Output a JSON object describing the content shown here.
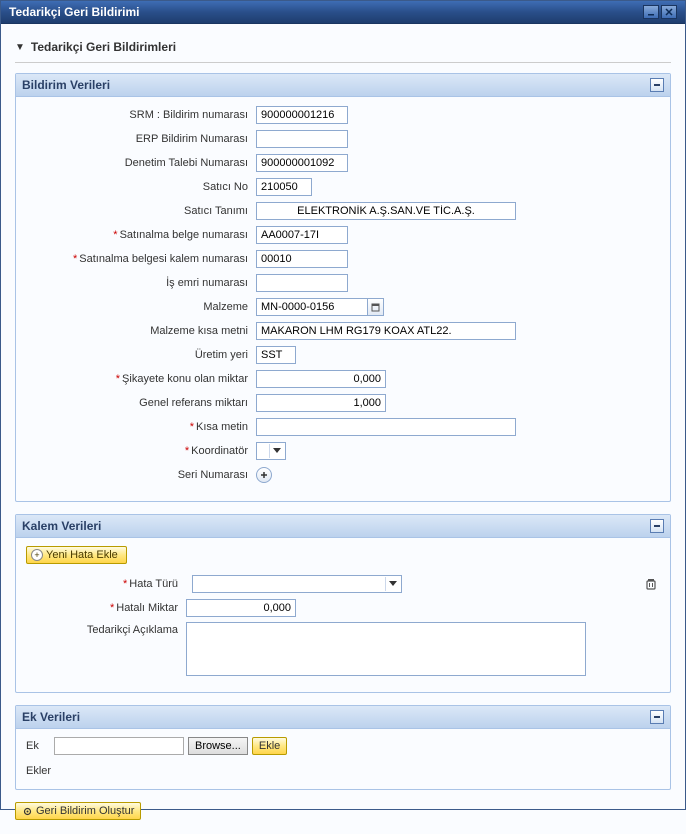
{
  "window": {
    "title": "Tedarikçi Geri Bildirimi"
  },
  "section1": {
    "title": "Tedarikçi Geri Bildirimleri"
  },
  "panelBildirim": {
    "title": "Bildirim Verileri",
    "fields": {
      "srm_label": "SRM : Bildirim numarası",
      "srm_value": "900000001216",
      "erp_label": "ERP Bildirim Numarası",
      "erp_value": "",
      "denetim_label": "Denetim Talebi Numarası",
      "denetim_value": "900000001092",
      "satici_no_label": "Satıcı No",
      "satici_no_value": "210050",
      "satici_tanimi_label": "Satıcı Tanımı",
      "satici_tanimi_value": "ELEKTRONİK A.Ş.SAN.VE TİC.A.Ş.",
      "satinalma_belge_label": "Satınalma belge numarası",
      "satinalma_belge_value": "AA0007-17I",
      "satinalma_kalem_label": "Satınalma belgesi kalem numarası",
      "satinalma_kalem_value": "00010",
      "is_emri_label": "İş emri numarası",
      "is_emri_value": "",
      "malzeme_label": "Malzeme",
      "malzeme_value": "MN-0000-0156",
      "malzeme_kisa_label": "Malzeme kısa metni",
      "malzeme_kisa_value": "MAKARON LHM RG179 KOAX ATL22.",
      "uretim_label": "Üretim yeri",
      "uretim_value": "SST",
      "sikayet_label": "Şikayete konu olan miktar",
      "sikayet_value": "0,000",
      "genel_label": "Genel referans miktarı",
      "genel_value": "1,000",
      "kisa_metin_label": "Kısa metin",
      "kisa_metin_value": "",
      "koord_label": "Koordinatör",
      "seri_label": "Seri Numarası"
    }
  },
  "panelKalem": {
    "title": "Kalem Verileri",
    "new_error_btn": "Yeni Hata Ekle",
    "hata_turu_label": "Hata Türü",
    "hatali_miktar_label": "Hatalı Miktar",
    "hatali_miktar_value": "0,000",
    "tedarikci_aciklama_label": "Tedarikçi Açıklama",
    "tedarikci_aciklama_value": ""
  },
  "panelEk": {
    "title": "Ek Verileri",
    "ek_label": "Ek",
    "browse_label": "Browse...",
    "ekle_label": "Ekle",
    "ekler_label": "Ekler"
  },
  "actions": {
    "create_feedback": "Geri Bildirim Oluştur"
  }
}
